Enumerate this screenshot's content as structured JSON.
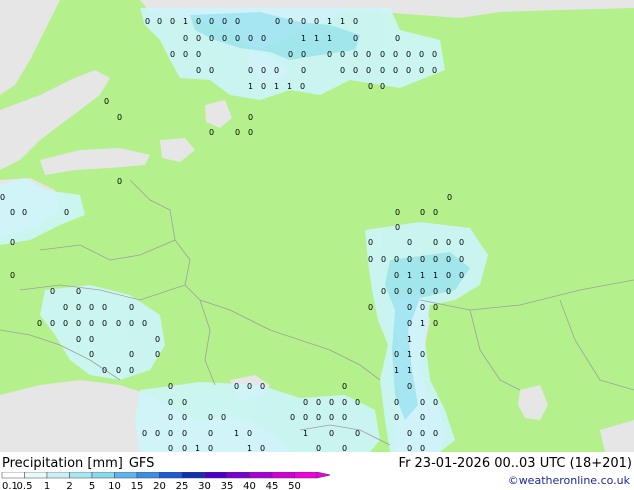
{
  "map": {
    "colors": {
      "land": "#b4f08c",
      "water": "#e6e6e6",
      "precip_light": "#cdf5fa",
      "precip": "#a0e6f5",
      "border": "#a0a0a0"
    },
    "precip_values": [
      "0",
      "1",
      "0",
      "0",
      "1",
      "0",
      "1",
      "1",
      "0",
      "0",
      "0",
      "1",
      "1",
      "1",
      "0",
      "0",
      "1",
      "0",
      "0",
      "0",
      "1",
      "0",
      "0",
      "1",
      "1",
      "0"
    ]
  },
  "footer": {
    "title": "Precipitation [mm]",
    "model": "GFS",
    "datetime": "Fr 23-01-2026 00..03 UTC (18+201)",
    "copyright": "©weatheronline.co.uk"
  },
  "legend": {
    "labels": [
      "0.1",
      "0.5",
      "1",
      "2",
      "5",
      "10",
      "15",
      "20",
      "25",
      "30",
      "35",
      "40",
      "45",
      "50"
    ],
    "colors": [
      "#ffffff",
      "#e6fafa",
      "#c8f0f5",
      "#a8e6f0",
      "#88d8f0",
      "#5fb4f0",
      "#3c8ce6",
      "#1e5ad2",
      "#1030b0",
      "#4a00c8",
      "#7a00d2",
      "#a800d8",
      "#d000d8",
      "#ee00e0"
    ]
  }
}
